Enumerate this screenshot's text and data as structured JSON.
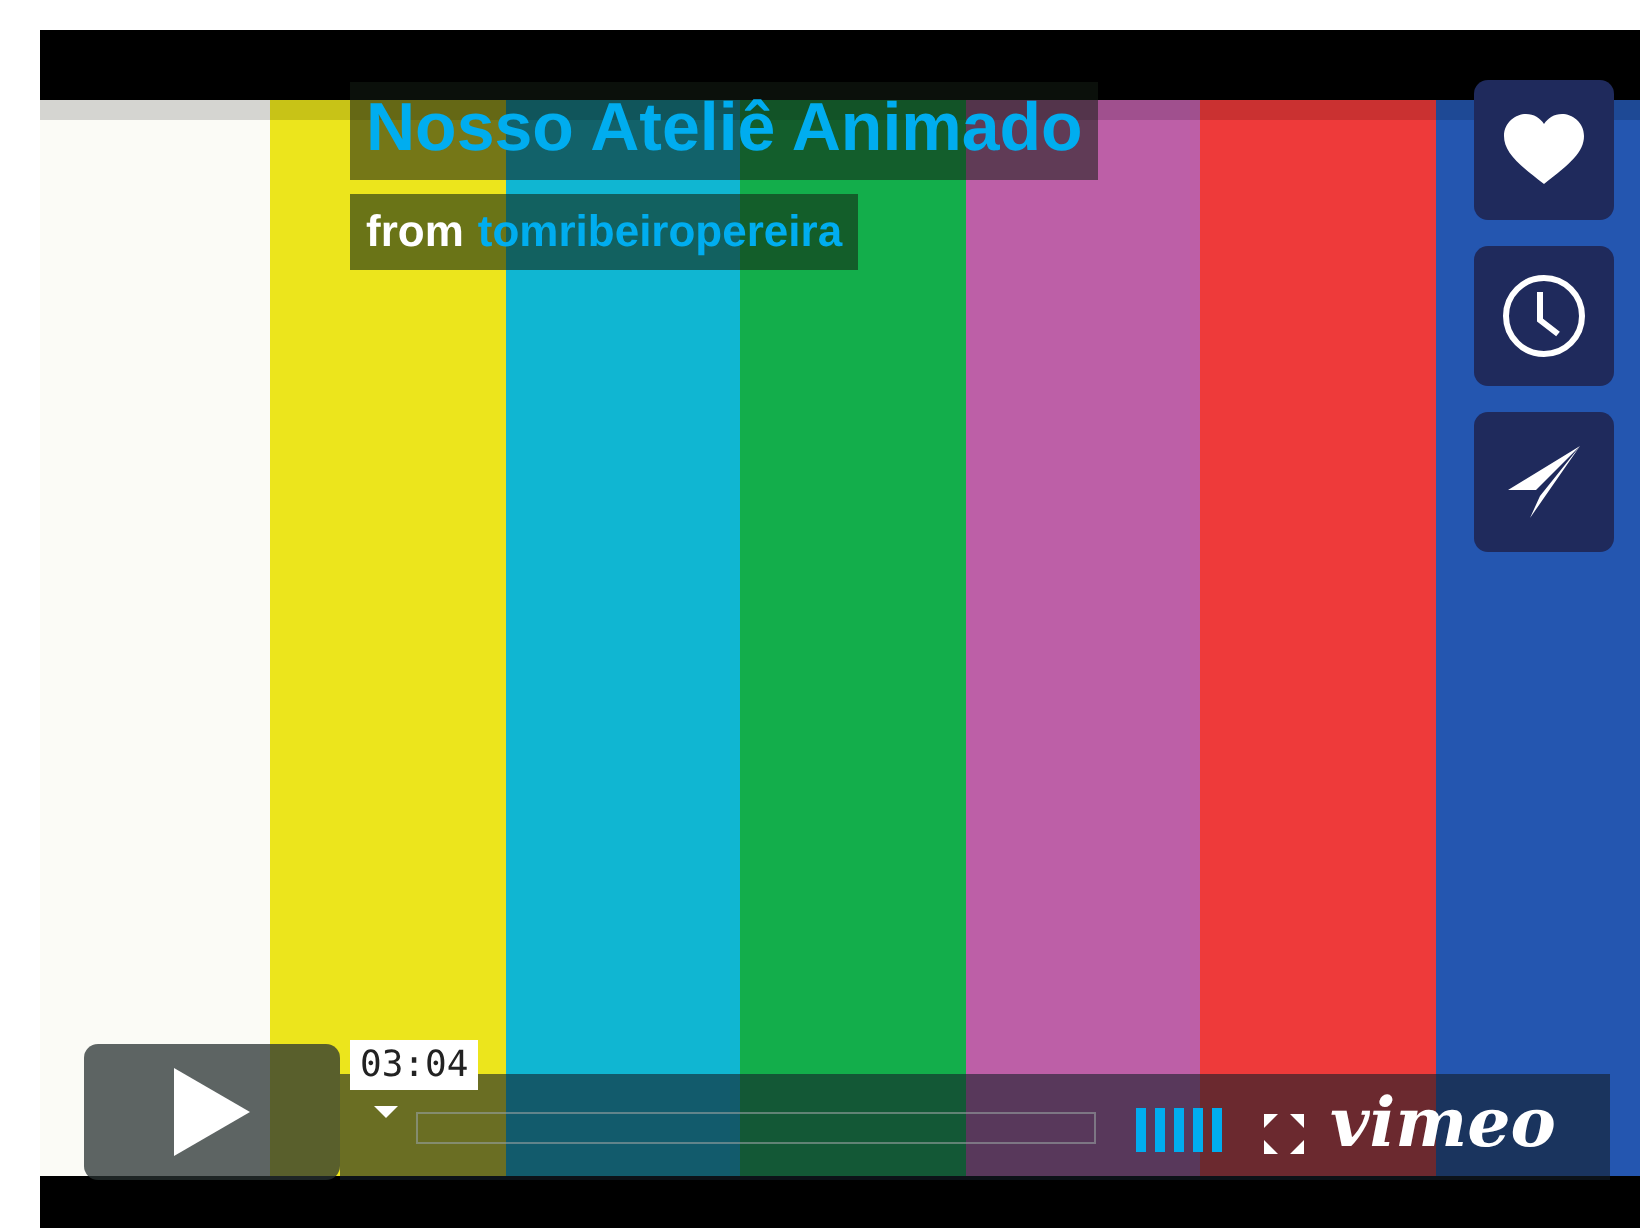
{
  "title": "Nosso Ateliê Animado",
  "byline": {
    "prefix": "from",
    "author": "tomribeiropereira"
  },
  "side_buttons": [
    {
      "kind": "like"
    },
    {
      "kind": "watch_later"
    },
    {
      "kind": "share"
    }
  ],
  "controls": {
    "time": "03:04",
    "logo": "vimeo"
  }
}
